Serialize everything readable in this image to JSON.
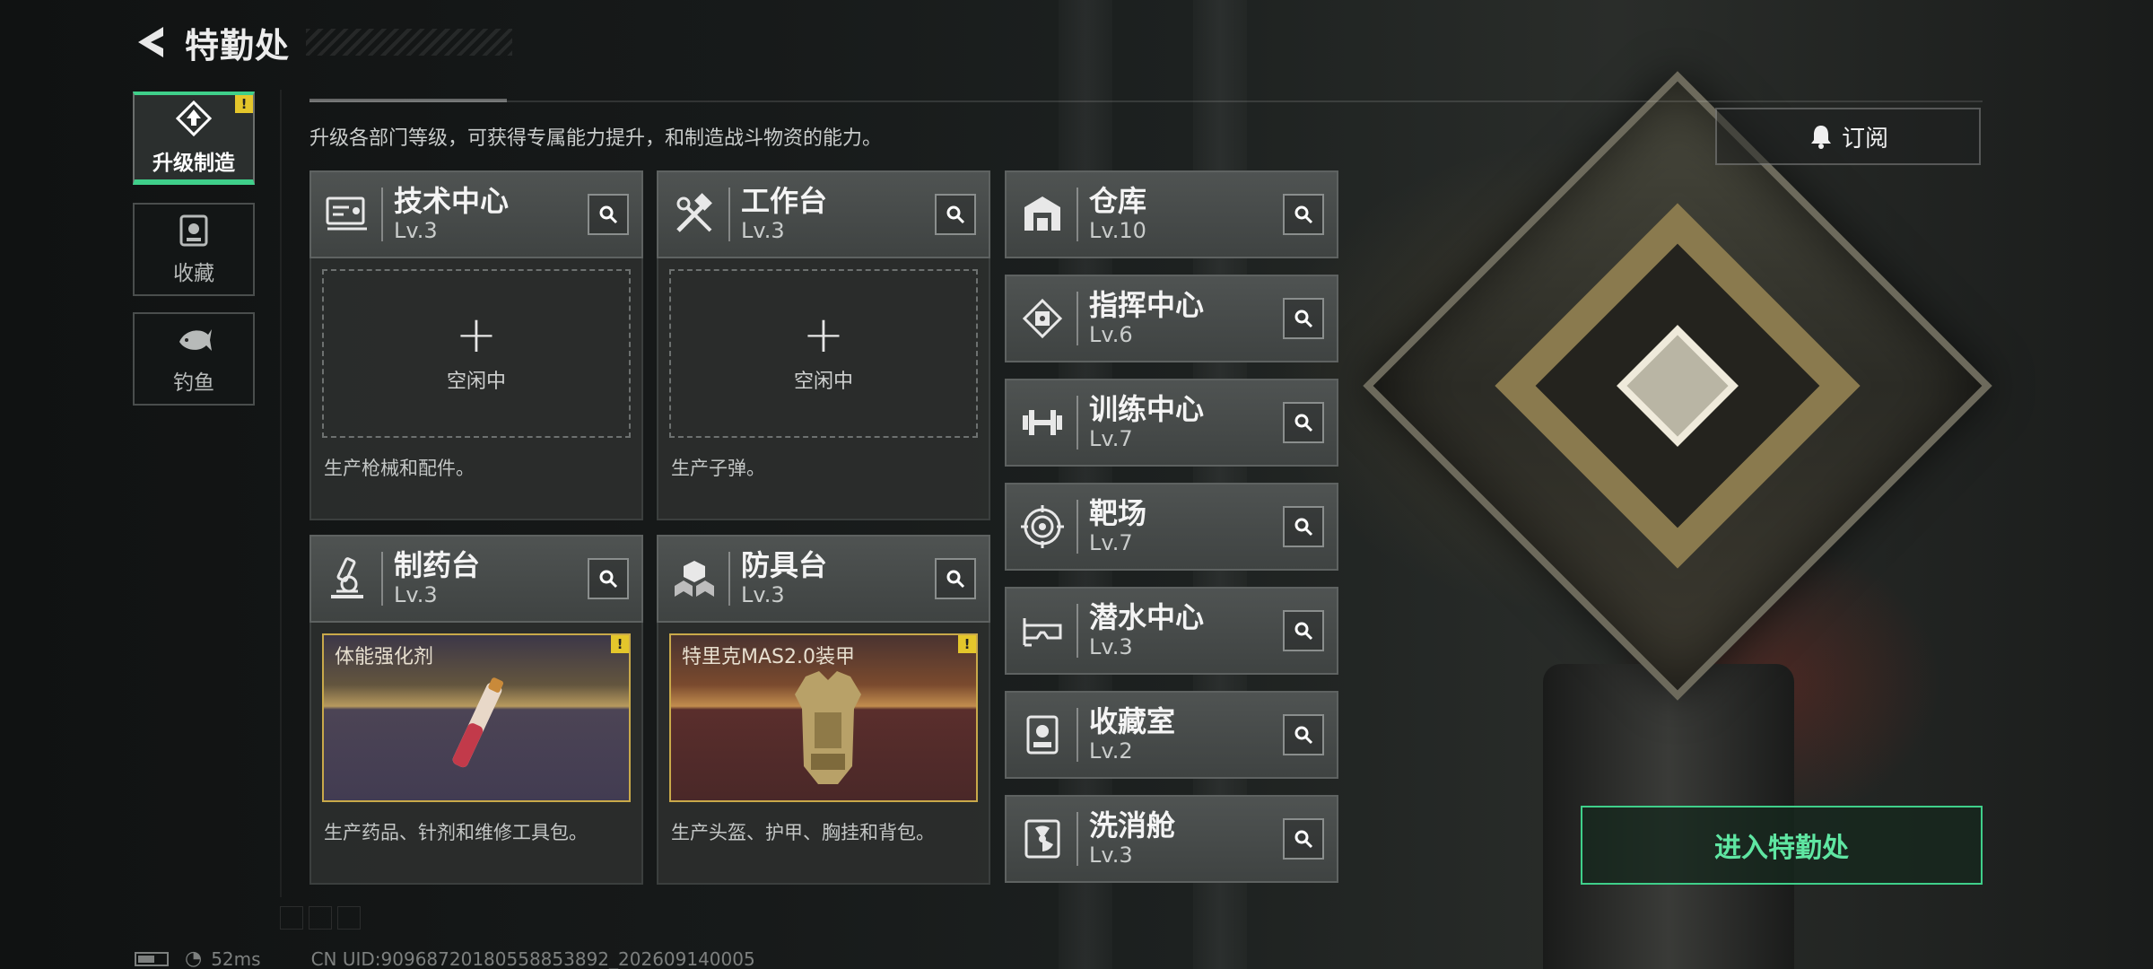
{
  "header": {
    "title": "特勤处"
  },
  "tabs": [
    {
      "label": "升级制造",
      "active": true,
      "badge": "!",
      "icon": "upgrade-icon"
    },
    {
      "label": "收藏",
      "active": false,
      "icon": "collection-icon"
    },
    {
      "label": "钓鱼",
      "active": false,
      "icon": "fish-icon"
    }
  ],
  "description": "升级各部门等级，可获得专属能力提升，和制造战斗物资的能力。",
  "subscribe": {
    "label": "订阅",
    "icon": "bell-icon"
  },
  "workshops": [
    {
      "name": "技术中心",
      "level": "Lv.3",
      "icon": "tech-center-icon",
      "slot": {
        "type": "empty",
        "plus": "+",
        "status": "空闲中"
      },
      "desc": "生产枪械和配件。"
    },
    {
      "name": "工作台",
      "level": "Lv.3",
      "icon": "workbench-icon",
      "slot": {
        "type": "empty",
        "plus": "+",
        "status": "空闲中"
      },
      "desc": "生产子弹。"
    },
    {
      "name": "制药台",
      "level": "Lv.3",
      "icon": "pharmacy-icon",
      "slot": {
        "type": "item",
        "item_name": "体能强化剂",
        "badge": "!"
      },
      "desc": "生产药品、针剂和维修工具包。"
    },
    {
      "name": "防具台",
      "level": "Lv.3",
      "icon": "armor-bench-icon",
      "slot": {
        "type": "item",
        "item_name": "特里克MAS2.0装甲",
        "badge": "!"
      },
      "desc": "生产头盔、护甲、胸挂和背包。"
    }
  ],
  "facilities": [
    {
      "name": "仓库",
      "level": "Lv.10",
      "icon": "warehouse-icon"
    },
    {
      "name": "指挥中心",
      "level": "Lv.6",
      "icon": "command-center-icon"
    },
    {
      "name": "训练中心",
      "level": "Lv.7",
      "icon": "dumbbell-icon"
    },
    {
      "name": "靶场",
      "level": "Lv.7",
      "icon": "target-icon"
    },
    {
      "name": "潜水中心",
      "level": "Lv.3",
      "icon": "diving-mask-icon"
    },
    {
      "name": "收藏室",
      "level": "Lv.2",
      "icon": "collection-room-icon"
    },
    {
      "name": "洗消舱",
      "level": "Lv.3",
      "icon": "decontamination-icon"
    }
  ],
  "enter_button": {
    "label": "进入特勤处"
  },
  "status_bar": {
    "ping": "52ms",
    "uid": "CN UID:90968720180558853892_202609140005"
  },
  "colors": {
    "accent_green": "#3fcf8a",
    "warning_yellow": "#e4c62b",
    "item_gold": "#c9a94a"
  }
}
